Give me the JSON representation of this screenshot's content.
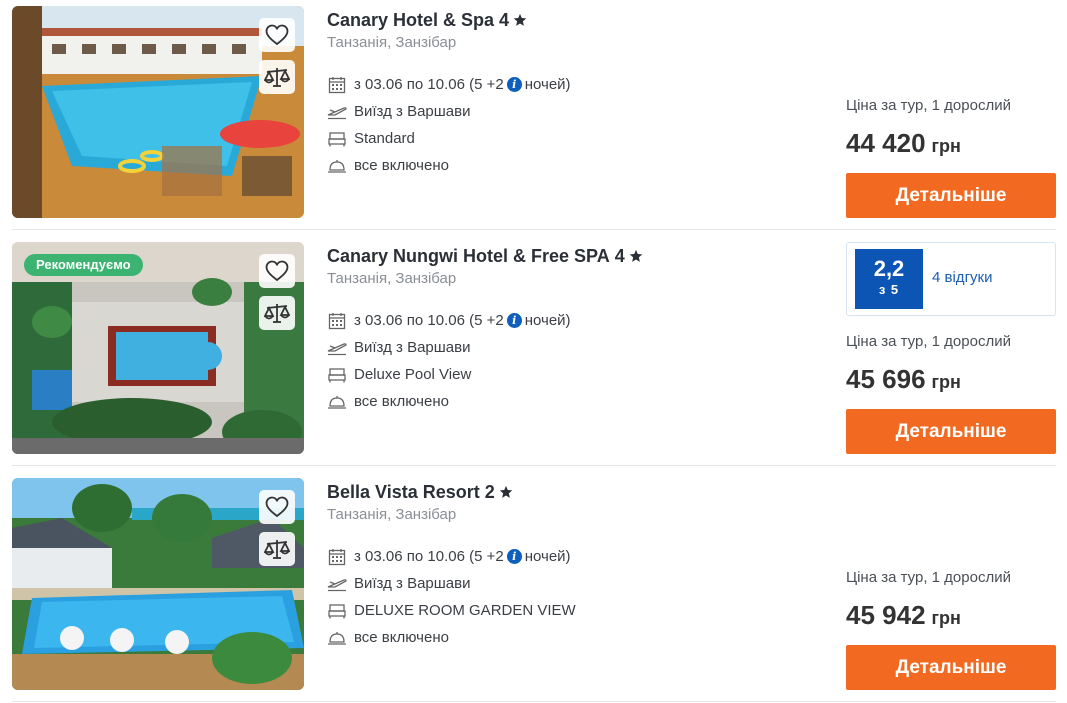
{
  "hotels": [
    {
      "name": "Canary Hotel & Spa",
      "stars": "4",
      "location": "Танзанія, Занзібар",
      "dates": "з 03.06 по 10.06 (5 +2",
      "nights_label": "ночей)",
      "departure": "Виїзд з Варшави",
      "room": "Standard",
      "meal": "все включено",
      "price_label": "Ціна за тур, 1 дорослий",
      "price": "44 420",
      "currency": "грн",
      "button": "Детальніше"
    },
    {
      "name": "Canary Nungwi Hotel & Free SPA",
      "stars": "4",
      "badge": "Рекомендуємо",
      "location": "Танзанія, Занзібар",
      "dates": "з 03.06 по 10.06 (5 +2",
      "nights_label": "ночей)",
      "departure": "Виїзд з Варшави",
      "room": "Deluxe Pool View",
      "meal": "все включено",
      "rating": "2,2",
      "rating_of": "з 5",
      "reviews": "4 відгуки",
      "price_label": "Ціна за тур, 1 дорослий",
      "price": "45 696",
      "currency": "грн",
      "button": "Детальніше"
    },
    {
      "name": "Bella Vista Resort",
      "stars": "2",
      "location": "Танзанія, Занзібар",
      "dates": "з 03.06 по 10.06 (5 +2",
      "nights_label": "ночей)",
      "departure": "Виїзд з Варшави",
      "room": "DELUXE ROOM GARDEN VIEW",
      "meal": "все включено",
      "price_label": "Ціна за тур, 1 дорослий",
      "price": "45 942",
      "currency": "грн",
      "button": "Детальніше"
    }
  ],
  "colors": {
    "accent_button": "#f26a21",
    "rating_bg": "#0d55b4",
    "badge_bg": "#3cb371",
    "info_icon": "#0f5fbe"
  },
  "icons": {
    "favorite": "heart-icon",
    "compare": "scales-icon",
    "star": "star-icon",
    "dates": "calendar-icon",
    "departure": "plane-icon",
    "room": "bed-icon",
    "meal": "cloche-icon",
    "info": "info-icon"
  }
}
